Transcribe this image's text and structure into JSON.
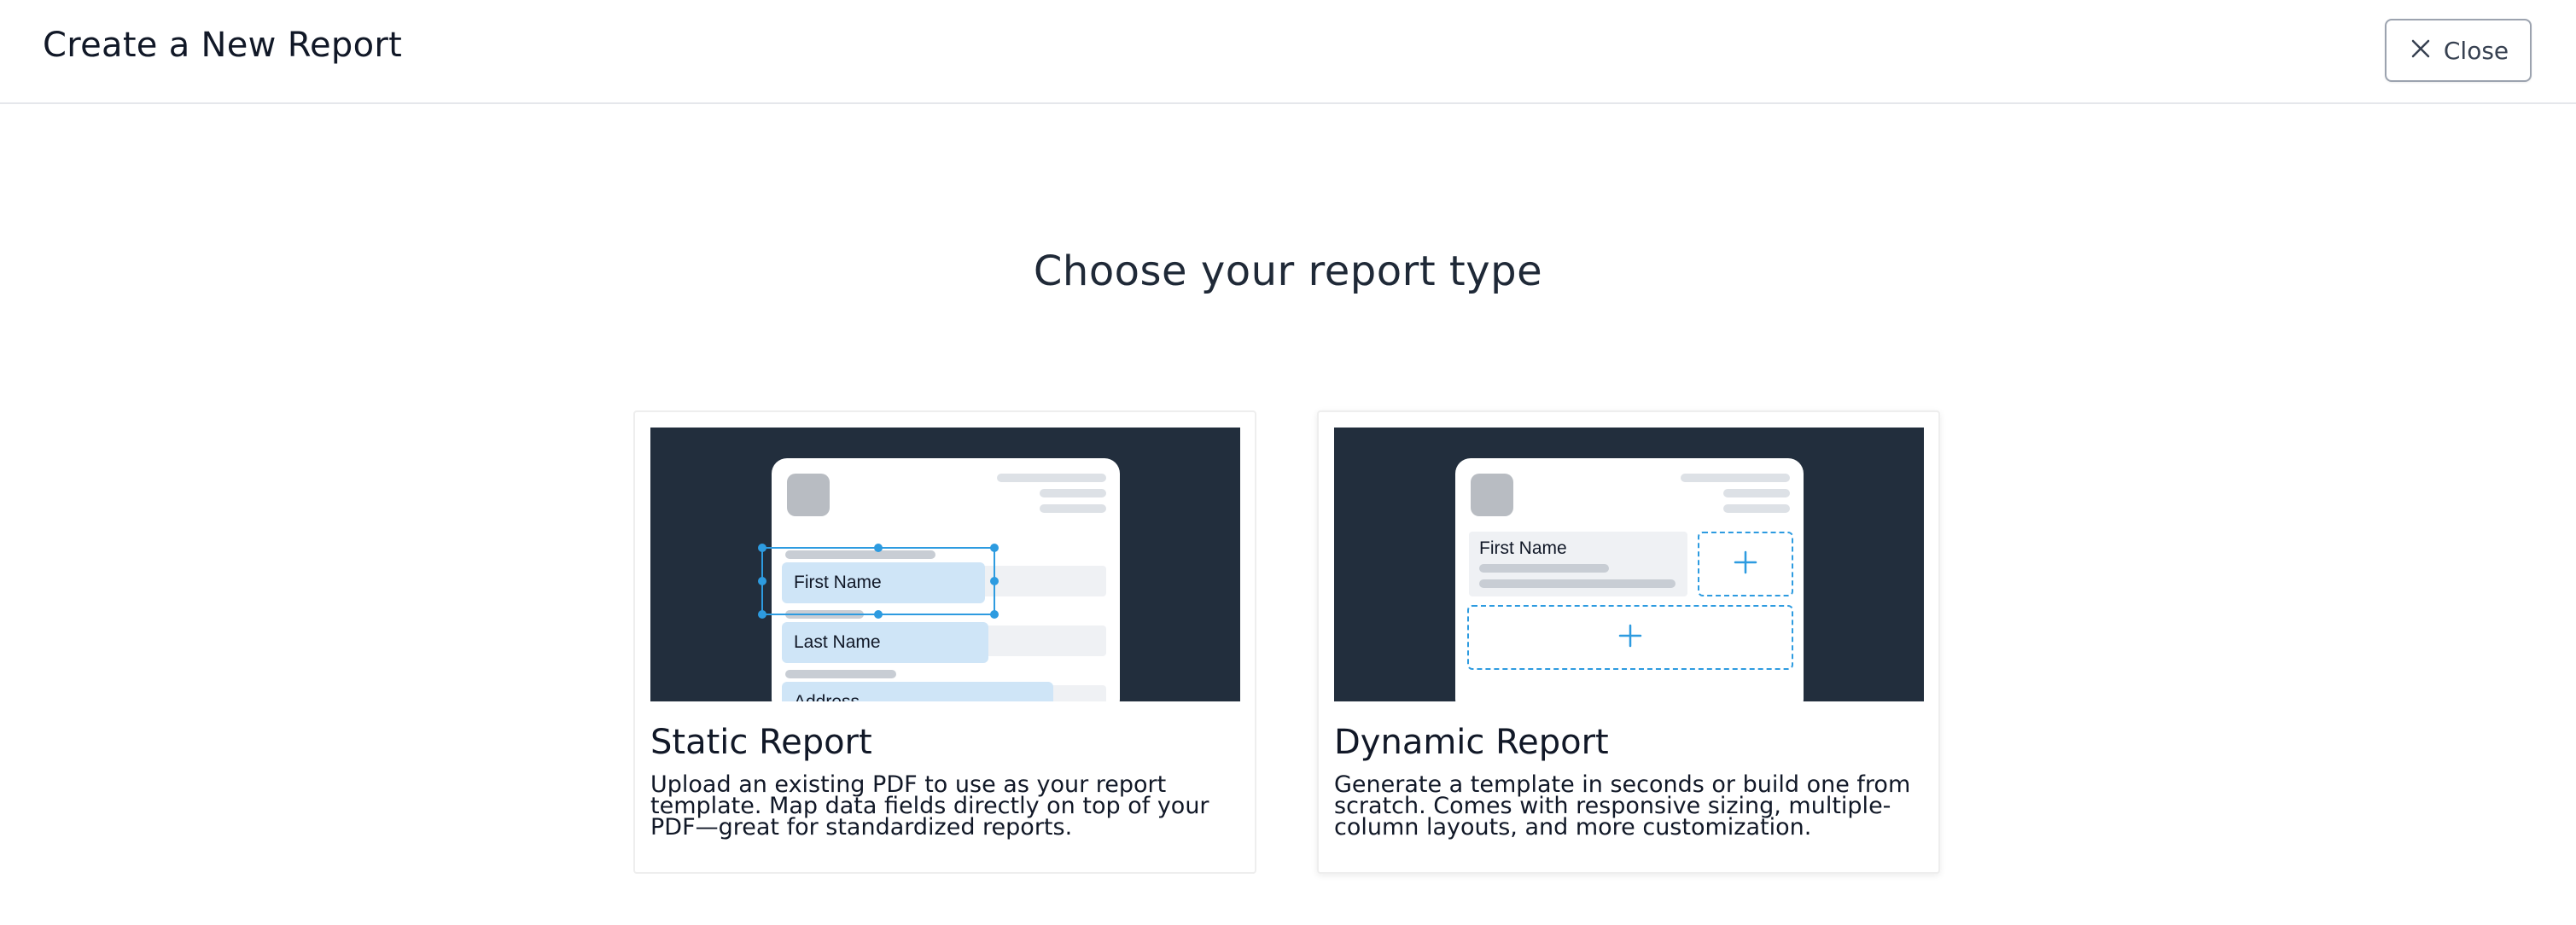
{
  "header": {
    "title": "Create a New Report",
    "close_label": "Close"
  },
  "main": {
    "heading": "Choose your report type"
  },
  "cards": [
    {
      "title": "Static Report",
      "description": "Upload an existing PDF to use as your report template. Map data fields directly on top of your PDF—great for standardized reports.",
      "preview_fields": [
        "First Name",
        "Last Name",
        "Address"
      ]
    },
    {
      "title": "Dynamic Report",
      "description": "Generate a template in seconds or build one from scratch. Comes with responsive sizing, multiple-column layouts, and more customization.",
      "preview_fields": [
        "First Name"
      ]
    }
  ],
  "icons": {
    "close": "close-icon",
    "add": "plus-icon"
  },
  "colors": {
    "preview_background": "#222e3d",
    "accent": "#2d9be0",
    "highlight": "#cfe5f7"
  }
}
